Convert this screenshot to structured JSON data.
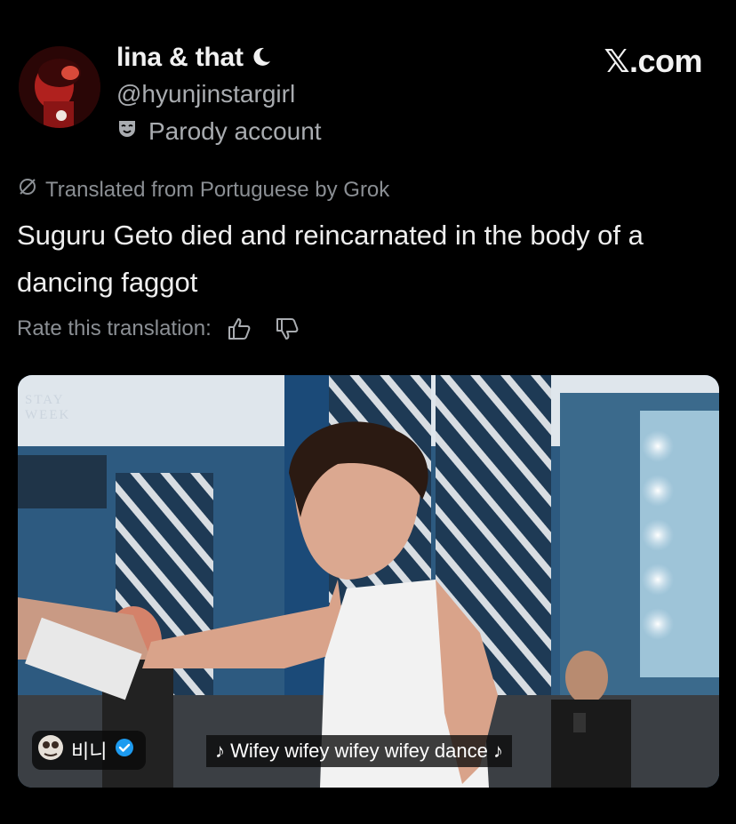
{
  "author": {
    "display_name": "lina & that",
    "handle": "@hyunjinstargirl",
    "label": "Parody account"
  },
  "brand": "𝕏.com",
  "translation_note": "Translated from Portuguese by Grok",
  "tweet_text": "Suguru Geto died and reincarnated in the body of a dancing faggot",
  "rate_label": "Rate this translation:",
  "media": {
    "watermark_line1": "STAY",
    "watermark_line2": "WEEK",
    "username": "비니",
    "subtitle": "♪ Wifey wifey wifey wifey dance ♪"
  },
  "colors": {
    "background": "#000000",
    "verified": "#1d9bf0",
    "muted": "#8b8f94"
  },
  "icons": [
    "moon-icon",
    "theater-mask-icon",
    "translate-icon",
    "thumbs-up-icon",
    "thumbs-down-icon",
    "verified-badge-icon"
  ]
}
